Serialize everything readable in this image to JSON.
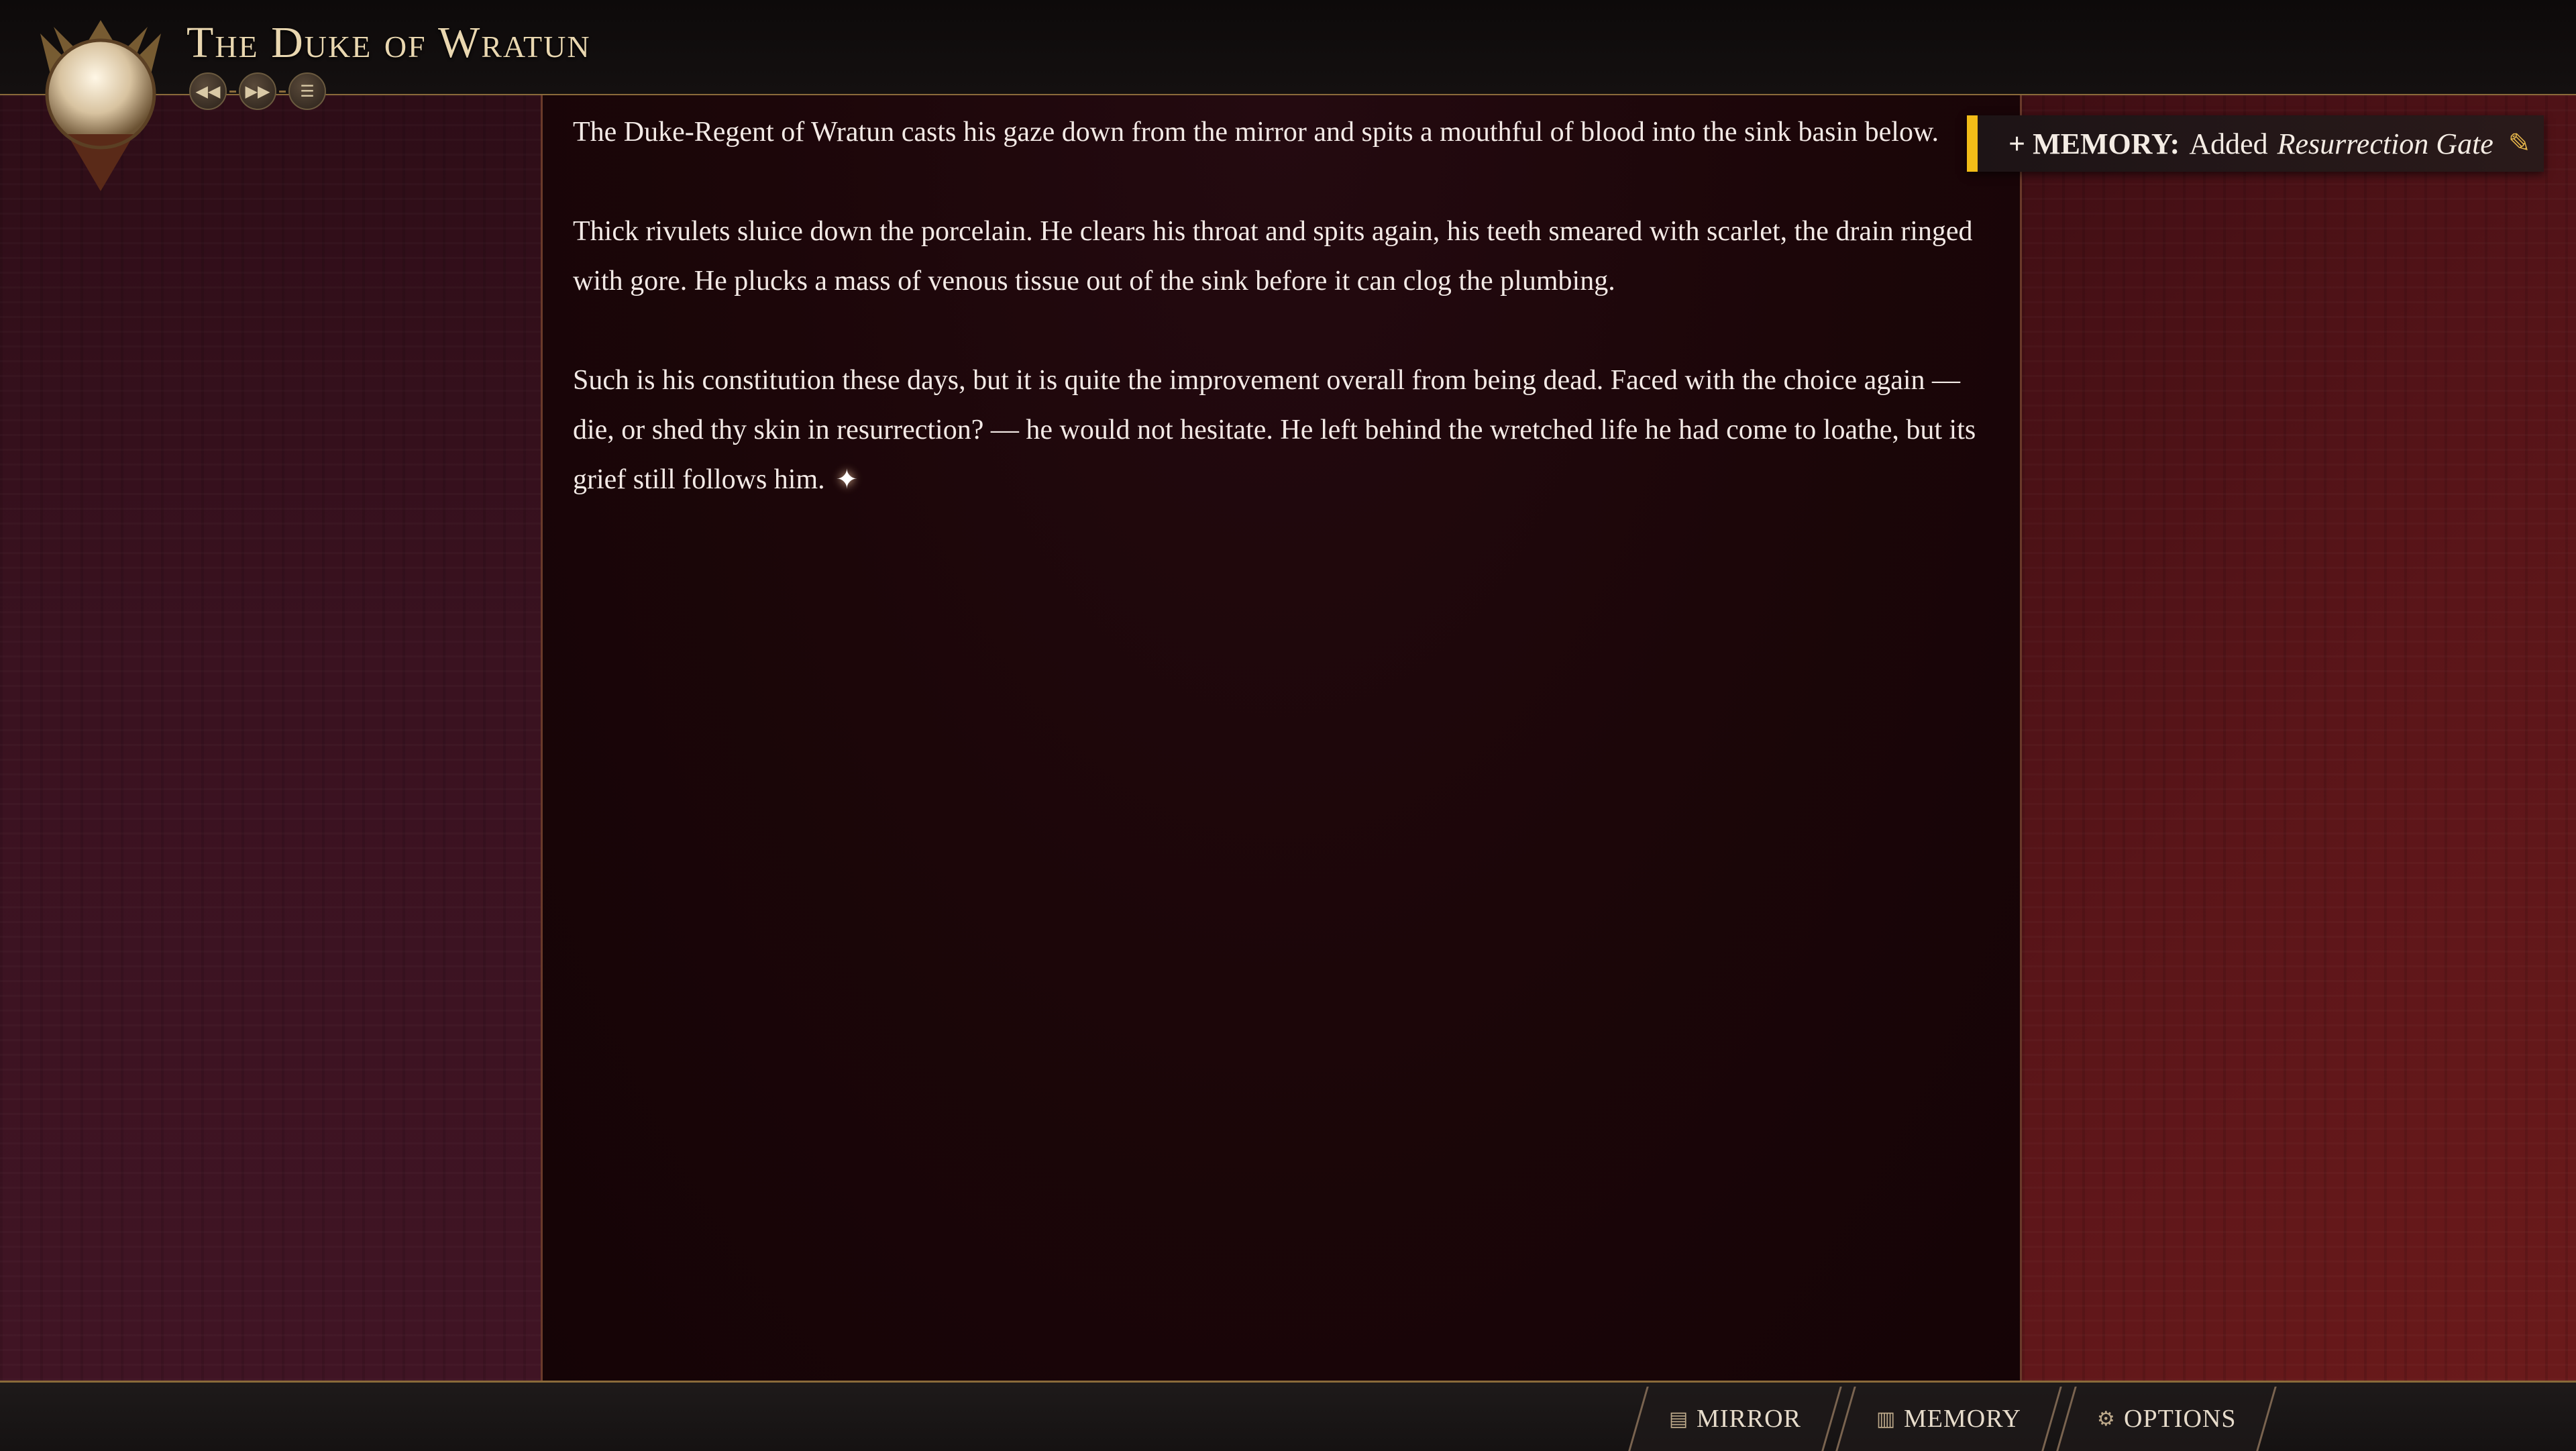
{
  "header": {
    "title": "The Duke of Wratun",
    "controls": {
      "rewind_icon": "rewind-icon",
      "fastforward_icon": "fast-forward-icon",
      "menu_icon": "menu-icon"
    }
  },
  "story": {
    "paragraphs": [
      "The Duke-Regent of Wratun casts his gaze down from the mirror and spits a mouthful of blood into the sink basin below.",
      "Thick rivulets sluice down the porcelain. He clears his throat and spits again, his teeth smeared with scarlet, the drain ringed with gore. He plucks a mass of venous tissue out of the sink before it can clog the plumbing.",
      "Such is his constitution these days, but it is quite the improvement overall from being dead. Faced with the choice again — die, or shed thy skin in resurrection? — he would not hesitate. He left behind the wretched life he had come to loathe, but its grief still follows him."
    ],
    "sparkle": "✦"
  },
  "toast": {
    "prefix": "+ MEMORY:",
    "verb": "Added",
    "item": "Resurrection Gate",
    "accent_color": "#f2bc18"
  },
  "bottom_tabs": [
    {
      "label": "MIRROR",
      "icon": "mirror-icon"
    },
    {
      "label": "MEMORY",
      "icon": "memory-icon"
    },
    {
      "label": "OPTIONS",
      "icon": "gear-icon"
    }
  ]
}
